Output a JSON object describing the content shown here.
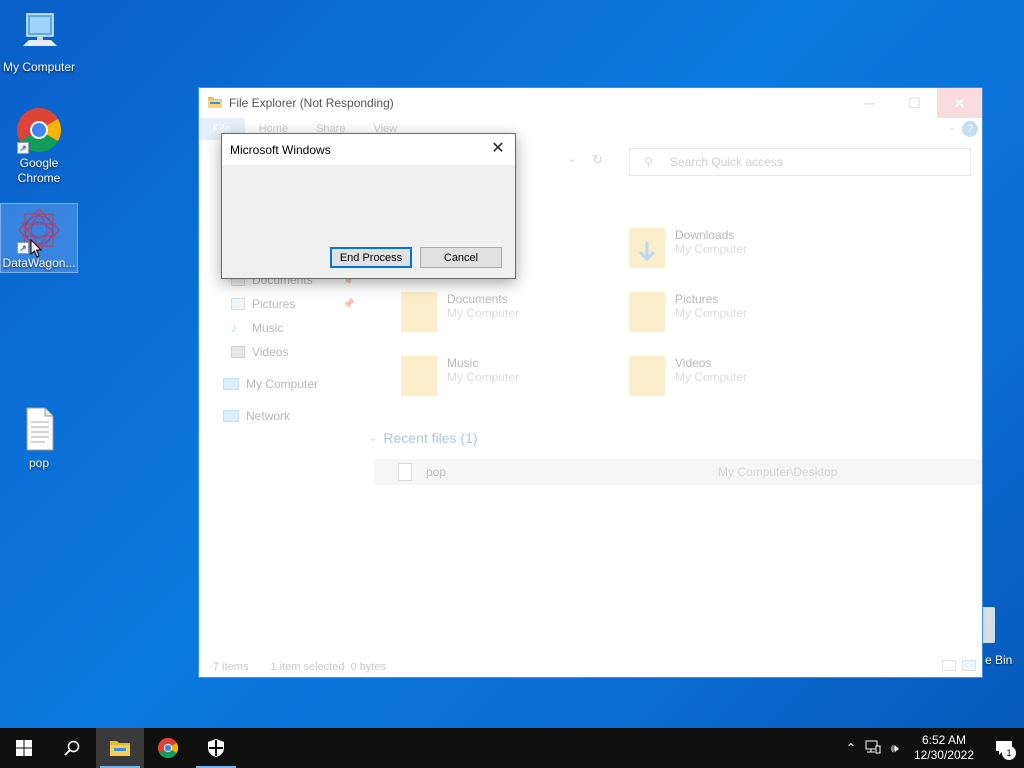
{
  "desktop": {
    "icons": [
      {
        "label": "My Computer"
      },
      {
        "label": "Google Chrome"
      },
      {
        "label": "DataWagon..."
      },
      {
        "label": "pop"
      }
    ],
    "recycle_bin_label": "e Bin"
  },
  "explorer": {
    "title": "File Explorer (Not Responding)",
    "ribbon_tabs": [
      "File",
      "Home",
      "Share",
      "View"
    ],
    "search_placeholder": "Search Quick access",
    "nav_items": [
      {
        "label": "Documents",
        "pinned": true
      },
      {
        "label": "Pictures",
        "pinned": true
      },
      {
        "label": "Music",
        "pinned": false
      },
      {
        "label": "Videos",
        "pinned": false
      },
      {
        "label": "My Computer",
        "pinned": false
      },
      {
        "label": "Network",
        "pinned": false
      }
    ],
    "folders": [
      {
        "name": "Downloads",
        "location": "My Computer"
      },
      {
        "name": "Documents",
        "location": "My Computer"
      },
      {
        "name": "Pictures",
        "location": "My Computer"
      },
      {
        "name": "Music",
        "location": "My Computer"
      },
      {
        "name": "Videos",
        "location": "My Computer"
      }
    ],
    "recent_header": "Recent files (1)",
    "recent_files": [
      {
        "name": "pop",
        "path": "My Computer\\Desktop"
      }
    ],
    "status": {
      "items": "7 items",
      "selected": "1 item selected  0 bytes"
    }
  },
  "dialog": {
    "title": "Microsoft Windows",
    "end_process_label": "End Process",
    "cancel_label": "Cancel"
  },
  "taskbar": {
    "clock_time": "6:52 AM",
    "clock_date": "12/30/2022",
    "notification_count": "1"
  },
  "colors": {
    "accent": "#0078d7",
    "desktop": "#0a6fd6",
    "taskbar": "#101010"
  }
}
